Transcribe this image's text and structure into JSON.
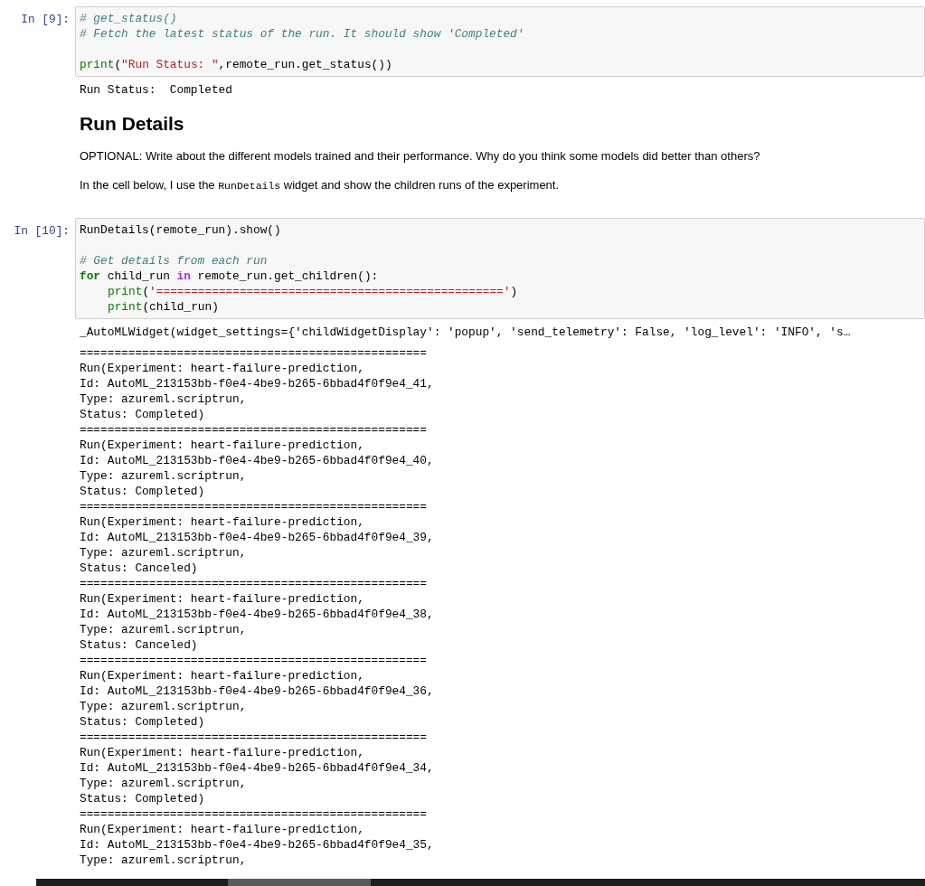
{
  "cells": [
    {
      "kind": "code",
      "prompt": "In [9]:",
      "lines": [
        {
          "tokens": [
            {
              "text": "# get_status()",
              "kind": "comment"
            }
          ]
        },
        {
          "tokens": [
            {
              "text": "# Fetch the latest status of the run. It should show 'Completed'",
              "kind": "comment"
            }
          ]
        },
        {
          "blank_before": true,
          "tokens": [
            {
              "text": "print",
              "kind": "builtin"
            },
            {
              "text": "(",
              "kind": "plain"
            },
            {
              "text": "\"Run Status: \"",
              "kind": "string"
            },
            {
              "text": ",remote_run.get_status())",
              "kind": "plain"
            }
          ]
        }
      ],
      "output": [
        "Run Status:  Completed"
      ]
    },
    {
      "kind": "markdown",
      "heading": "Run Details",
      "paragraphs": [
        [
          {
            "text": "OPTIONAL: Write about the different models trained and their performance. Why do you think some models did better than others?",
            "code": false
          }
        ],
        [
          {
            "text": "In the cell below, I use the ",
            "code": false
          },
          {
            "text": "RunDetails",
            "code": true
          },
          {
            "text": " widget and show the children runs of the experiment.",
            "code": false
          }
        ]
      ]
    },
    {
      "kind": "code",
      "prompt": "In [10]:",
      "lines": [
        {
          "tokens": [
            {
              "text": "RunDetails(remote_run).show()",
              "kind": "plain"
            }
          ]
        },
        {
          "blank_before": true,
          "tokens": [
            {
              "text": "# Get details from each run",
              "kind": "comment"
            }
          ]
        },
        {
          "tokens": [
            {
              "text": "for",
              "kind": "keyword"
            },
            {
              "text": " child_run ",
              "kind": "plain"
            },
            {
              "text": "in",
              "kind": "operator"
            },
            {
              "text": " remote_run.get_children():",
              "kind": "plain"
            }
          ]
        },
        {
          "indented": true,
          "tokens": [
            {
              "text": "print",
              "kind": "builtin"
            },
            {
              "text": "(",
              "kind": "plain"
            },
            {
              "text": "'=================================================='",
              "kind": "string"
            },
            {
              "text": ")",
              "kind": "plain"
            }
          ]
        },
        {
          "indented": true,
          "tokens": [
            {
              "text": "print",
              "kind": "builtin"
            },
            {
              "text": "(child_run)",
              "kind": "plain"
            }
          ]
        }
      ],
      "widget_output": "_AutoMLWidget(widget_settings={'childWidgetDisplay': 'popup', 'send_telemetry': False, 'log_level': 'INFO', 's…",
      "output": [
        "==================================================",
        "Run(Experiment: heart-failure-prediction,",
        "Id: AutoML_213153bb-f0e4-4be9-b265-6bbad4f0f9e4_41,",
        "Type: azureml.scriptrun,",
        "Status: Completed)",
        "==================================================",
        "Run(Experiment: heart-failure-prediction,",
        "Id: AutoML_213153bb-f0e4-4be9-b265-6bbad4f0f9e4_40,",
        "Type: azureml.scriptrun,",
        "Status: Completed)",
        "==================================================",
        "Run(Experiment: heart-failure-prediction,",
        "Id: AutoML_213153bb-f0e4-4be9-b265-6bbad4f0f9e4_39,",
        "Type: azureml.scriptrun,",
        "Status: Canceled)",
        "==================================================",
        "Run(Experiment: heart-failure-prediction,",
        "Id: AutoML_213153bb-f0e4-4be9-b265-6bbad4f0f9e4_38,",
        "Type: azureml.scriptrun,",
        "Status: Canceled)",
        "==================================================",
        "Run(Experiment: heart-failure-prediction,",
        "Id: AutoML_213153bb-f0e4-4be9-b265-6bbad4f0f9e4_36,",
        "Type: azureml.scriptrun,",
        "Status: Completed)",
        "==================================================",
        "Run(Experiment: heart-failure-prediction,",
        "Id: AutoML_213153bb-f0e4-4be9-b265-6bbad4f0f9e4_34,",
        "Type: azureml.scriptrun,",
        "Status: Completed)",
        "==================================================",
        "Run(Experiment: heart-failure-prediction,",
        "Id: AutoML_213153bb-f0e4-4be9-b265-6bbad4f0f9e4_35,",
        "Type: azureml.scriptrun,"
      ]
    }
  ]
}
